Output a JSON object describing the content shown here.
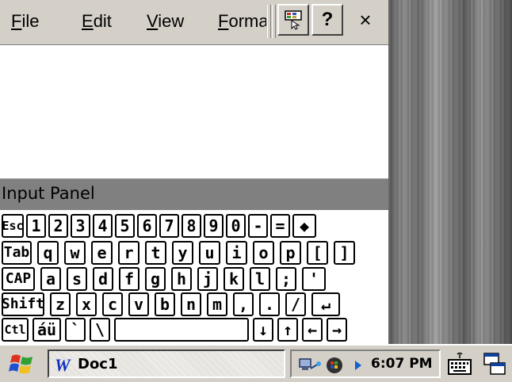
{
  "menu": {
    "file": {
      "accel": "F",
      "rest": "ile"
    },
    "edit": {
      "accel": "E",
      "rest": "dit"
    },
    "view": {
      "accel": "V",
      "rest": "iew"
    },
    "format": {
      "accel": "F",
      "rest": "ormat"
    }
  },
  "toolbar": {
    "help_label": "?",
    "close_label": "×"
  },
  "input_panel": {
    "title": "Input Panel"
  },
  "keyboard": {
    "rows": [
      [
        "Esc",
        "1",
        "2",
        "3",
        "4",
        "5",
        "6",
        "7",
        "8",
        "9",
        "0",
        "-",
        "=",
        "◆"
      ],
      [
        "Tab",
        "q",
        "w",
        "e",
        "r",
        "t",
        "y",
        "u",
        "i",
        "o",
        "p",
        "[",
        "]"
      ],
      [
        "CAP",
        "a",
        "s",
        "d",
        "f",
        "g",
        "h",
        "j",
        "k",
        "l",
        ";",
        "'"
      ],
      [
        "Shift",
        "z",
        "x",
        "c",
        "v",
        "b",
        "n",
        "m",
        ",",
        ".",
        "/",
        "↵"
      ],
      [
        "Ctl",
        "áü",
        "`",
        "\\",
        "",
        "↓",
        "↑",
        "←",
        "→"
      ]
    ]
  },
  "taskbar": {
    "task_label": "Doc1",
    "clock": "6:07 PM"
  },
  "colors": {
    "chrome": "#d4d0c8",
    "panel_title_bg": "#808080"
  }
}
